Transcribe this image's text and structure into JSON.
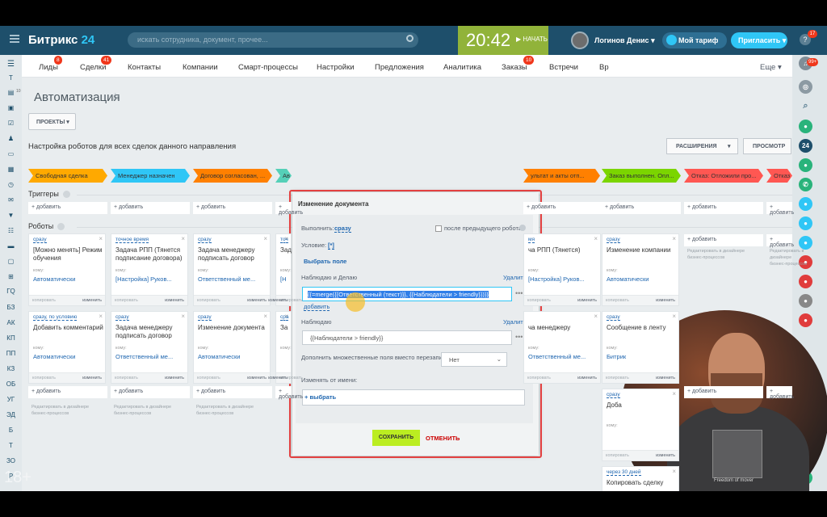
{
  "header": {
    "logo_main": "Битрикс",
    "logo_accent": "24",
    "search_placeholder": "искать сотрудника, документ, прочее...",
    "time": "20:42",
    "start_label": "НАЧАТЬ",
    "user": "Логинов Денис",
    "tariff": "Мой тариф",
    "invite": "Пригласить",
    "help_badge": "17"
  },
  "left_nav": {
    "counter": "10",
    "items": [
      "Т",
      "ГQ",
      "БЗ",
      "АК",
      "КП",
      "ПП",
      "КЗ",
      "ОБ",
      "УГ",
      "ЭД",
      "Б",
      "Т",
      "ЗО",
      "Р"
    ],
    "age_label": "18+"
  },
  "right_bar": {
    "notif_badge": "99+",
    "chat_label": "24"
  },
  "tabs": {
    "items": [
      {
        "label": "Лиды",
        "badge": "8"
      },
      {
        "label": "Сделки",
        "badge": "41"
      },
      {
        "label": "Контакты",
        "badge": ""
      },
      {
        "label": "Компании",
        "badge": ""
      },
      {
        "label": "Смарт-процессы",
        "badge": ""
      },
      {
        "label": "Настройки",
        "badge": ""
      },
      {
        "label": "Предложения",
        "badge": ""
      },
      {
        "label": "Аналитика",
        "badge": ""
      },
      {
        "label": "Заказы",
        "badge": "10"
      },
      {
        "label": "Встречи",
        "badge": ""
      },
      {
        "label": "Вр",
        "badge": ""
      }
    ],
    "more": "Еще"
  },
  "page": {
    "title": "Автоматизация",
    "projects_btn": "ПРОЕКТЫ",
    "setup_text": "Настройка роботов для всех сделок данного направления",
    "extensions_btn": "РАСШИРЕНИЯ",
    "view_btn": "ПРОСМОТР",
    "triggers_label": "Триггеры",
    "robots_label": "Роботы",
    "add_label": "+ добавить",
    "copy_label": "копировать",
    "edit_label": "изменить",
    "whom_label": "кому:",
    "hint_line1": "Редактировать в дизайнере",
    "hint_line2": "бизнес-процессов"
  },
  "stages": [
    {
      "label": "Свободная сделка",
      "color": "#ffa900"
    },
    {
      "label": "Менеджер назначен",
      "color": "#2fc6f6"
    },
    {
      "label": "Договор согласован, ...",
      "color": "#ff8000"
    },
    {
      "label": "Ав",
      "color": "#55d0b8"
    },
    {
      "label": "ультат и акты отп...",
      "color": "#ff8000"
    },
    {
      "label": "Заказ выполнен. Опл...",
      "color": "#7bd500"
    },
    {
      "label": "Отказ: Отложили про...",
      "color": "#ff5752"
    },
    {
      "label": "Отказ",
      "color": "#ff5752"
    }
  ],
  "robots_row1": [
    {
      "when": "сразу",
      "title": "[Можно менять] Режим обучения",
      "resp": "Автоматически"
    },
    {
      "when": "точное время",
      "title": "Задача РПП (Тянется подписание договора)",
      "resp": "[Настройка] Руков..."
    },
    {
      "when": "сразу",
      "title": "Задача менеджеру подписать договор",
      "resp": "Ответственный ме..."
    },
    {
      "when": "точ",
      "title": "Зад",
      "resp": "[Н"
    },
    {
      "when": "мя",
      "title": "ча РПП (Тянется)",
      "resp": "[Настройка] Руков..."
    },
    {
      "when": "сразу",
      "title": "Изменение компании",
      "resp": "Автоматически"
    }
  ],
  "robots_row2": [
    {
      "when": "сразу, по условию",
      "title": "Добавить комментарий",
      "resp": "Автоматически"
    },
    {
      "when": "сразу",
      "title": "Задача менеджеру подписать договор",
      "resp": "Ответственный ме..."
    },
    {
      "when": "сразу",
      "title": "Изменение документа",
      "resp": "Автоматически"
    },
    {
      "when": "сра",
      "title": "За",
      "resp": ""
    },
    {
      "when": "",
      "title": "ча менеджеру",
      "resp": "Ответственный ме..."
    },
    {
      "when": "сразу",
      "title": "Сообщение в ленту",
      "resp": "Битрик"
    }
  ],
  "col7_extra": [
    {
      "when": "сразу",
      "title": "Доба",
      "resp": ""
    },
    {
      "when": "через 30 дней",
      "title": "Копировать сделку",
      "resp": ""
    }
  ],
  "dialog": {
    "title": "Изменение документа",
    "execute_label": "Выполнить:",
    "execute_value": "сразу",
    "after_prev": "после предыдущего робота",
    "condition_label": "Условие:",
    "condition_value": "[*]",
    "choose_field": "Выбрать поле",
    "field1_label": "Наблюдаю и Делаю",
    "delete": "Удалить",
    "field1_value": "{{=merge({{Ответственный (текст)}}, {{Наблюдатели > friendly}})}}",
    "add": "добавить",
    "field2_label": "Наблюдаю",
    "field2_value": "{{Наблюдатели > friendly}}",
    "append_label": "Дополнить множественные поля вместо перезаписи:",
    "append_value": "Нет",
    "change_by_label": "Изменять от имени:",
    "choose": "+ выбрать",
    "save": "СОХРАНИТЬ",
    "cancel": "ОТМЕНИТЬ"
  },
  "webcam": {
    "shirt_text": "Freedom of mover"
  }
}
